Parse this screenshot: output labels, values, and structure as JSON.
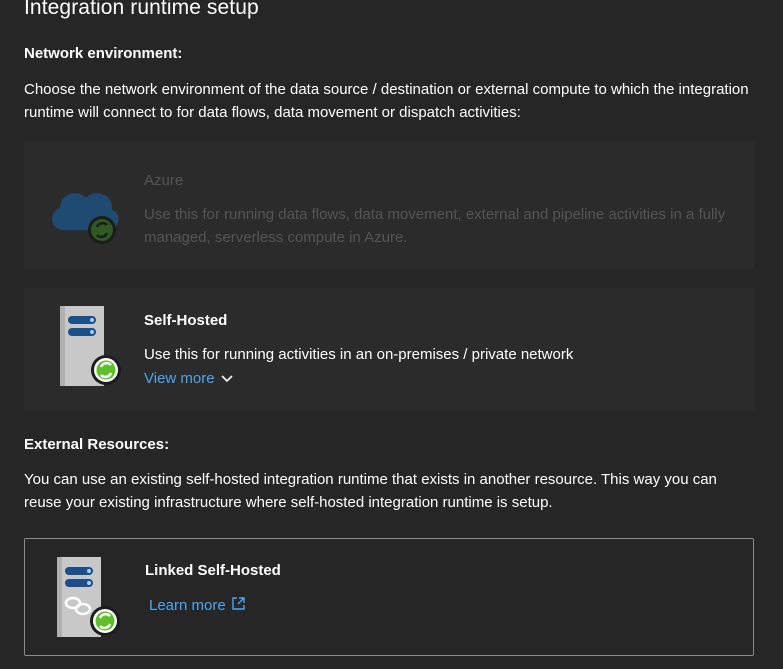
{
  "header": {
    "title": "Integration runtime setup"
  },
  "network": {
    "heading": "Network environment:",
    "description": "Choose the network environment of the data source / destination or external compute to which the integration runtime will connect to for data flows, data movement or dispatch activities:"
  },
  "options": {
    "azure": {
      "title": "Azure",
      "description": "Use this for running data flows, data movement, external and pipeline activities in a fully managed, serverless compute in Azure.",
      "icon": "cloud-icon",
      "state": "disabled"
    },
    "self_hosted": {
      "title": "Self-Hosted",
      "description": "Use this for running activities in an on-premises / private network",
      "link_label": "View more",
      "icon": "server-icon"
    }
  },
  "external": {
    "heading": "External Resources:",
    "description": "You can use an existing self-hosted integration runtime that exists in another resource. This way you can reuse your existing infrastructure where self-hosted integration runtime is setup.",
    "linked": {
      "title": "Linked Self-Hosted",
      "link_label": "Learn more",
      "icon": "linked-server-icon"
    }
  },
  "colors": {
    "background": "#262626",
    "card": "#2b2b2b",
    "link": "#4ca6f0",
    "badge_green": "#5fbf2a"
  }
}
